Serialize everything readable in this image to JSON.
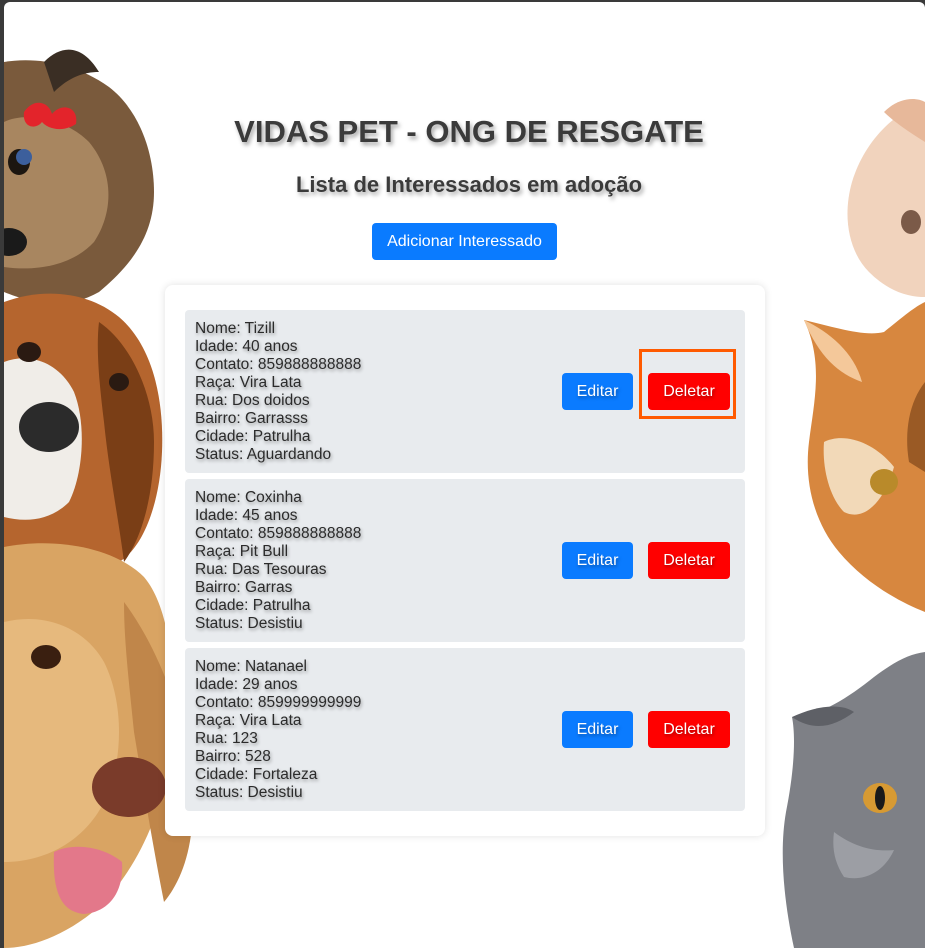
{
  "page": {
    "title": "VIDAS PET - ONG DE RESGATE",
    "subtitle": "Lista de Interessados em adoção",
    "add_button": "Adicionar Interessado"
  },
  "labels": {
    "edit": "Editar",
    "delete": "Deletar"
  },
  "interessados": [
    {
      "nome": "Nome: Tizill",
      "idade": "Idade: 40 anos",
      "contato": "Contato: 859888888888",
      "raca": "Raça: Vira Lata",
      "rua": "Rua: Dos doidos",
      "bairro": "Bairro: Garrasss",
      "cidade": "Cidade: Patrulha",
      "status": "Status: Aguardando"
    },
    {
      "nome": "Nome: Coxinha",
      "idade": "Idade: 45 anos",
      "contato": "Contato: 859888888888",
      "raca": "Raça: Pit Bull",
      "rua": "Rua: Das Tesouras",
      "bairro": "Bairro: Garras",
      "cidade": "Cidade: Patrulha",
      "status": "Status: Desistiu"
    },
    {
      "nome": "Nome: Natanael",
      "idade": "Idade: 29 anos",
      "contato": "Contato: 859999999999",
      "raca": "Raça: Vira Lata",
      "rua": "Rua: 123",
      "bairro": "Bairro: 528",
      "cidade": "Cidade: Fortaleza",
      "status": "Status: Desistiu"
    }
  ],
  "colors": {
    "primary": "#0a7bff",
    "danger": "#ff0000",
    "highlight": "#ff5a00",
    "card": "#e8ebee"
  },
  "background_illustrations": [
    "yorkshire-dog",
    "basset-hound-dog",
    "golden-retriever-dog",
    "white-kitten",
    "orange-cat",
    "gray-cat"
  ]
}
